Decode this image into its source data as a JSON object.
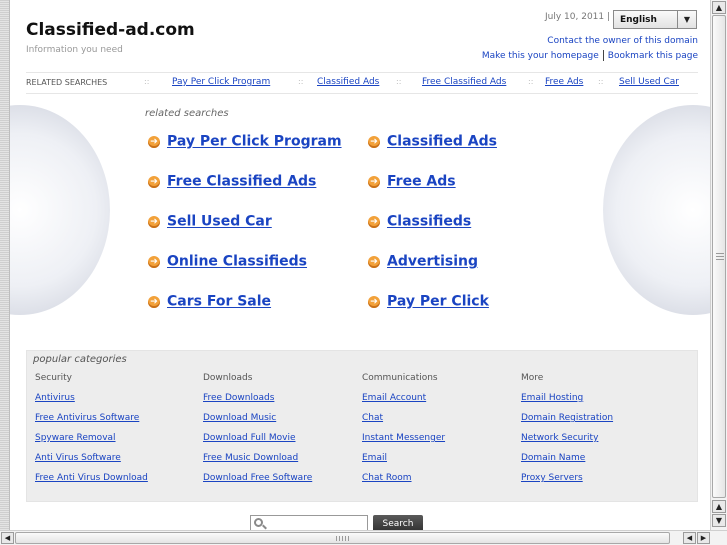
{
  "header": {
    "site_title": "Classified-ad.com",
    "site_subtitle": "Information you need",
    "date": "July 10, 2011 |",
    "language": "English",
    "contact_link": "Contact the owner of this domain",
    "homepage_link": "Make this your homepage",
    "bookmark_link": "Bookmark this page"
  },
  "related_bar": {
    "label": "RELATED SEARCHES",
    "separator": "::",
    "items": [
      "Pay Per Click Program",
      "Classified Ads",
      "Free Classified Ads",
      "Free Ads",
      "Sell Used Car"
    ]
  },
  "related_searches": {
    "caption": "related searches",
    "left": [
      "Pay Per Click Program",
      "Free Classified Ads",
      "Sell Used Car",
      "Online Classifieds",
      "Cars For Sale"
    ],
    "right": [
      "Classified Ads",
      "Free Ads",
      "Classifieds",
      "Advertising",
      "Pay Per Click"
    ]
  },
  "popular": {
    "caption": "popular categories",
    "columns": [
      {
        "heading": "Security",
        "links": [
          "Antivirus",
          "Free Antivirus Software",
          "Spyware Removal",
          "Anti Virus Software",
          "Free Anti Virus Download"
        ]
      },
      {
        "heading": "Downloads",
        "links": [
          "Free Downloads",
          "Download Music",
          "Download Full Movie",
          "Free Music Download",
          "Download Free Software"
        ]
      },
      {
        "heading": "Communications",
        "links": [
          "Email Account",
          "Chat",
          "Instant Messenger",
          "Email",
          "Chat Room"
        ]
      },
      {
        "heading": "More",
        "links": [
          "Email Hosting",
          "Domain Registration",
          "Network Security",
          "Domain Name",
          "Proxy Servers"
        ]
      }
    ]
  },
  "search": {
    "placeholder": "",
    "button_label": "Search"
  },
  "icons": {
    "bullet": "arrow-circle-icon",
    "search": "magnifier-icon"
  },
  "colors": {
    "link": "#1a44c2",
    "bullet": "#f2a13a",
    "panel": "#ededed"
  }
}
